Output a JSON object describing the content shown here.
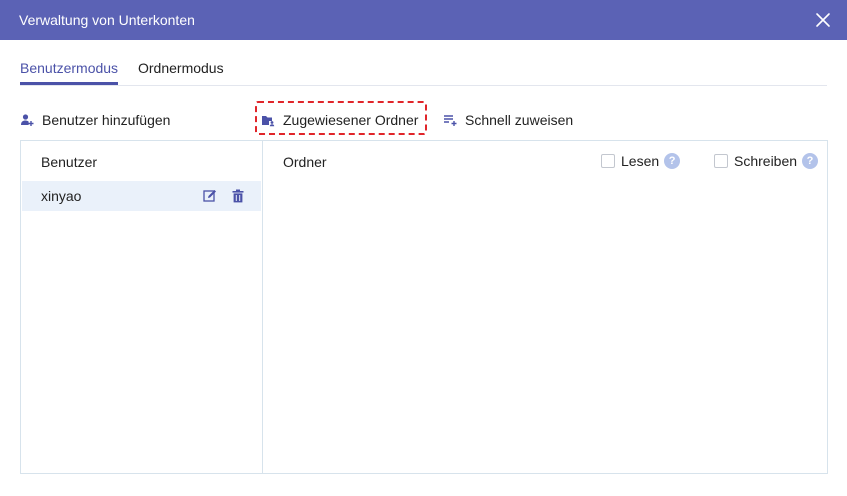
{
  "dialog": {
    "title": "Verwaltung von Unterkonten"
  },
  "tabs": [
    {
      "label": "Benutzermodus",
      "active": true
    },
    {
      "label": "Ordnermodus",
      "active": false
    }
  ],
  "toolbar": {
    "add_user": "Benutzer hinzufügen",
    "assigned_folder": "Zugewiesener Ordner",
    "quick_assign": "Schnell zuweisen"
  },
  "users_panel": {
    "header": "Benutzer",
    "users": [
      {
        "name": "xinyao"
      }
    ]
  },
  "folders_panel": {
    "header": "Ordner",
    "read_label": "Lesen",
    "write_label": "Schreiben",
    "help_glyph": "?"
  },
  "colors": {
    "title_bar": "#5b62b5",
    "accent": "#4b52a8",
    "highlight_border": "#e0252a",
    "selected_row": "#eaf1fa",
    "help_icon": "#b3c3ea"
  }
}
